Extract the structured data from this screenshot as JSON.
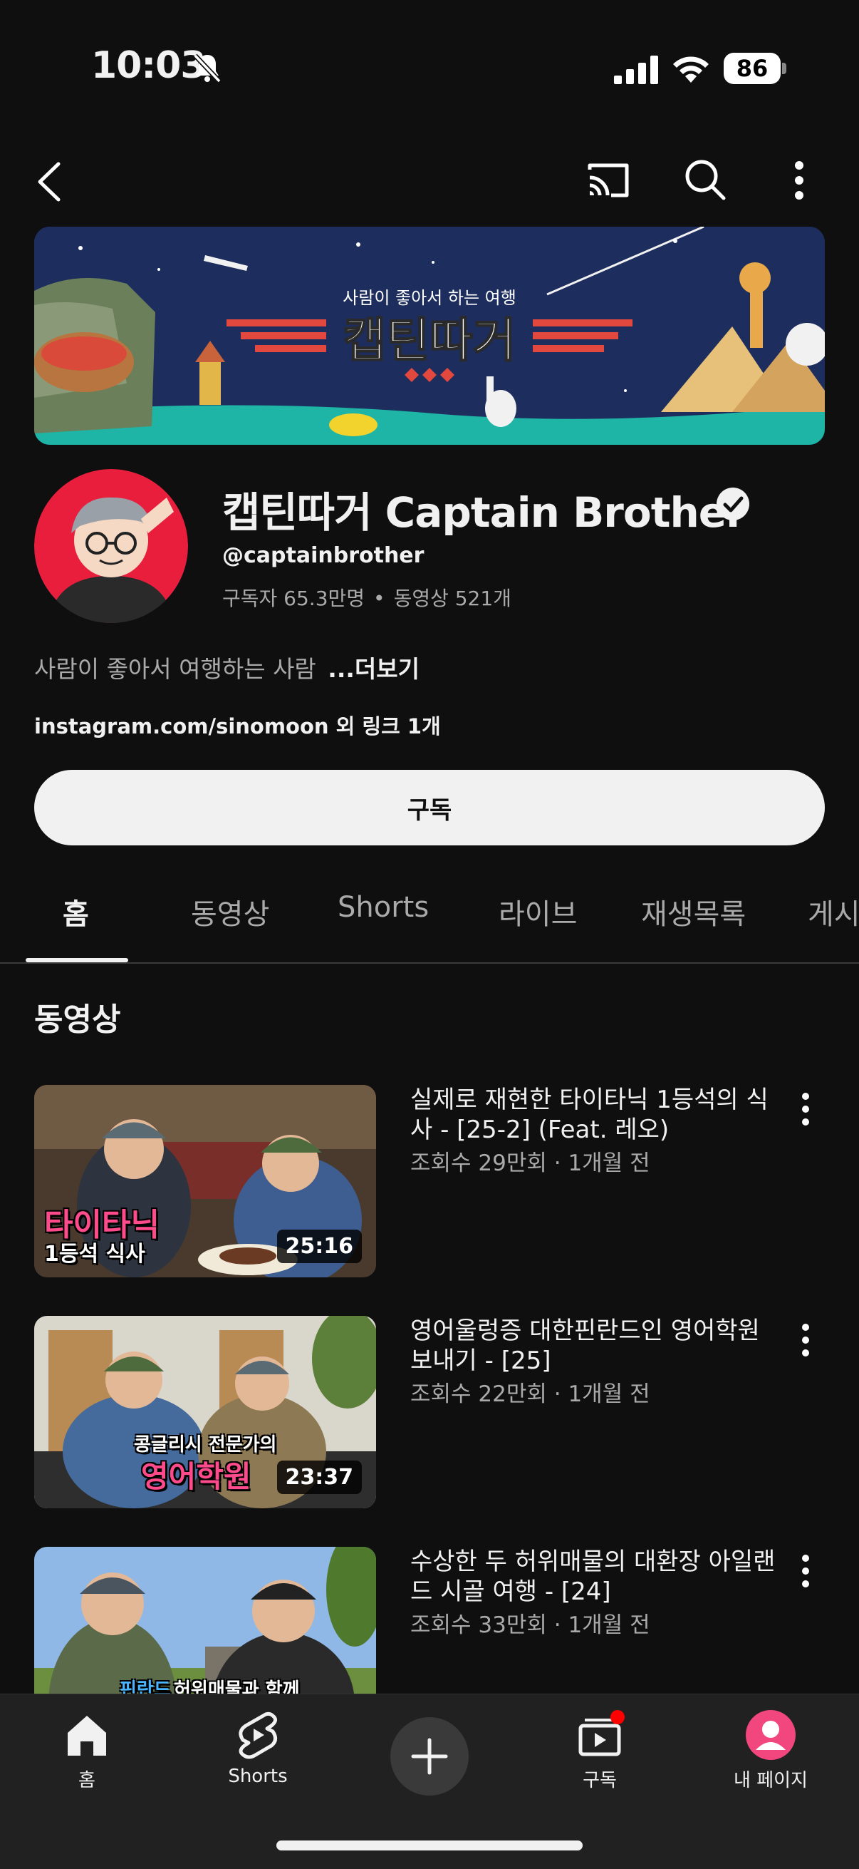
{
  "status_bar": {
    "time": "10:03",
    "battery": "86"
  },
  "banner": {
    "tagline": "사람이 좋아서 하는 여행",
    "logo_text": "캡틴따거"
  },
  "channel": {
    "name": "캡틴따거 Captain Brother",
    "handle": "@captainbrother",
    "subscribers": "구독자 65.3만명",
    "videos_count": "동영상 521개",
    "stats_separator": "•",
    "description": "사람이 좋아서 여행하는 사람",
    "more_label": "...더보기",
    "link_text": "instagram.com/sinomoon 외 링크 1개",
    "subscribe_label": "구독"
  },
  "tabs": [
    {
      "label": "홈",
      "active": true
    },
    {
      "label": "동영상",
      "active": false
    },
    {
      "label": "Shorts",
      "active": false
    },
    {
      "label": "라이브",
      "active": false
    },
    {
      "label": "재생목록",
      "active": false
    },
    {
      "label": "게시",
      "active": false
    }
  ],
  "section": {
    "title": "동영상"
  },
  "videos": [
    {
      "title": "실제로 재현한 타이타닉 1등석의 식사 - [25-2] (Feat. 레오)",
      "meta": "조회수 29만회 · 1개월 전",
      "duration": "25:16",
      "caption_1": "타이타닉",
      "caption_2": "1등석 식사"
    },
    {
      "title": "영어울렁증 대한핀란드인 영어학원 보내기 - [25]",
      "meta": "조회수 22만회 · 1개월 전",
      "duration": "23:37",
      "caption_1": "콩글리시 전문가의",
      "caption_2": "영어학원"
    },
    {
      "title": "수상한 두 허위매물의 대환장 아일랜드 시골 여행 - [24]",
      "meta": "조회수 33만회 · 1개월 전",
      "duration": "",
      "caption_1": "핀란드",
      "caption_2": "허위매물과 함께"
    }
  ],
  "bottom_nav": {
    "home": "홈",
    "shorts": "Shorts",
    "subscriptions": "구독",
    "my_page": "내 페이지"
  },
  "colors": {
    "background": "#0f0f0f",
    "banner_navy": "#1d2e5e",
    "banner_teal": "#1fb5a6",
    "logo_red": "#e2483d",
    "notification_red": "#ff0000",
    "avatar_pink": "#f2467f"
  },
  "icons": [
    "mute-icon",
    "signal-icon",
    "wifi-icon",
    "back-icon",
    "cast-icon",
    "search-icon",
    "more-icon",
    "verified-icon",
    "home-icon",
    "shorts-icon",
    "create-icon",
    "subscriptions-icon",
    "profile-icon"
  ]
}
